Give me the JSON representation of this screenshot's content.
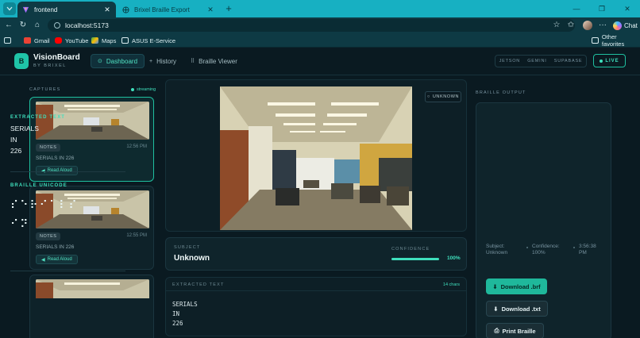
{
  "browser": {
    "tabs": [
      {
        "title": "frontend",
        "active": true
      },
      {
        "title": "Brixel Braille Export",
        "active": false
      }
    ],
    "url": "localhost:5173",
    "chat_label": "Chat",
    "bookmarks": [
      "Gmail",
      "YouTube",
      "Maps",
      "ASUS E-Service"
    ],
    "other_favorites": "Other favorites"
  },
  "app": {
    "logo_letter": "B",
    "brand": "VisionBoard",
    "brand_sub": "BY BRIXEL",
    "nav": [
      {
        "label": "Dashboard",
        "icon": "⊙"
      },
      {
        "label": "History",
        "icon": "+"
      },
      {
        "label": "Braille Viewer",
        "icon": "⠿"
      }
    ],
    "tech": [
      "JETSON",
      "GEMINI",
      "SUPABASE"
    ],
    "live_label": "LIVE",
    "colors": {
      "accent": "#3fe0bd",
      "background": "#0a1a21"
    }
  },
  "captures": {
    "label": "CAPTURES",
    "streaming_label": "streaming",
    "items": [
      {
        "tag": "NOTES",
        "time": "12:56 PM",
        "text": "SERIALS IN 226",
        "action": "Read Aloud"
      },
      {
        "tag": "NOTES",
        "time": "12:55 PM",
        "text": "SERIALS IN 226",
        "action": "Read Aloud"
      }
    ]
  },
  "viewer": {
    "badge": "UNKNOWN",
    "subject_label": "SUBJECT",
    "subject_value": "Unknown",
    "confidence_label": "CONFIDENCE",
    "confidence_value": "100%",
    "confidence_fraction": 1.0,
    "extracted_label": "EXTRACTED TEXT",
    "chars_label": "14 chars",
    "extracted_lines": [
      "SERIALS",
      "IN",
      "226"
    ]
  },
  "braille_output": {
    "label": "BRAILLE OUTPUT",
    "extracted_label": "EXTRACTED TEXT",
    "lines": [
      "SERIALS",
      "IN",
      "226"
    ],
    "unicode_label": "BRAILLE UNICODE",
    "braille_lines": [
      "⠎⠑⠗⠊⠁⠇⠎",
      "⠊⠝"
    ],
    "meta": {
      "subject_line1": "Subject:",
      "subject_line2": "Unknown",
      "confidence_line1": "Confidence:",
      "confidence_line2": "100%",
      "time_line1": "3:56:38",
      "time_line2": "PM"
    },
    "buttons": [
      "Download .brf",
      "Download .txt",
      "Print Braille"
    ]
  }
}
